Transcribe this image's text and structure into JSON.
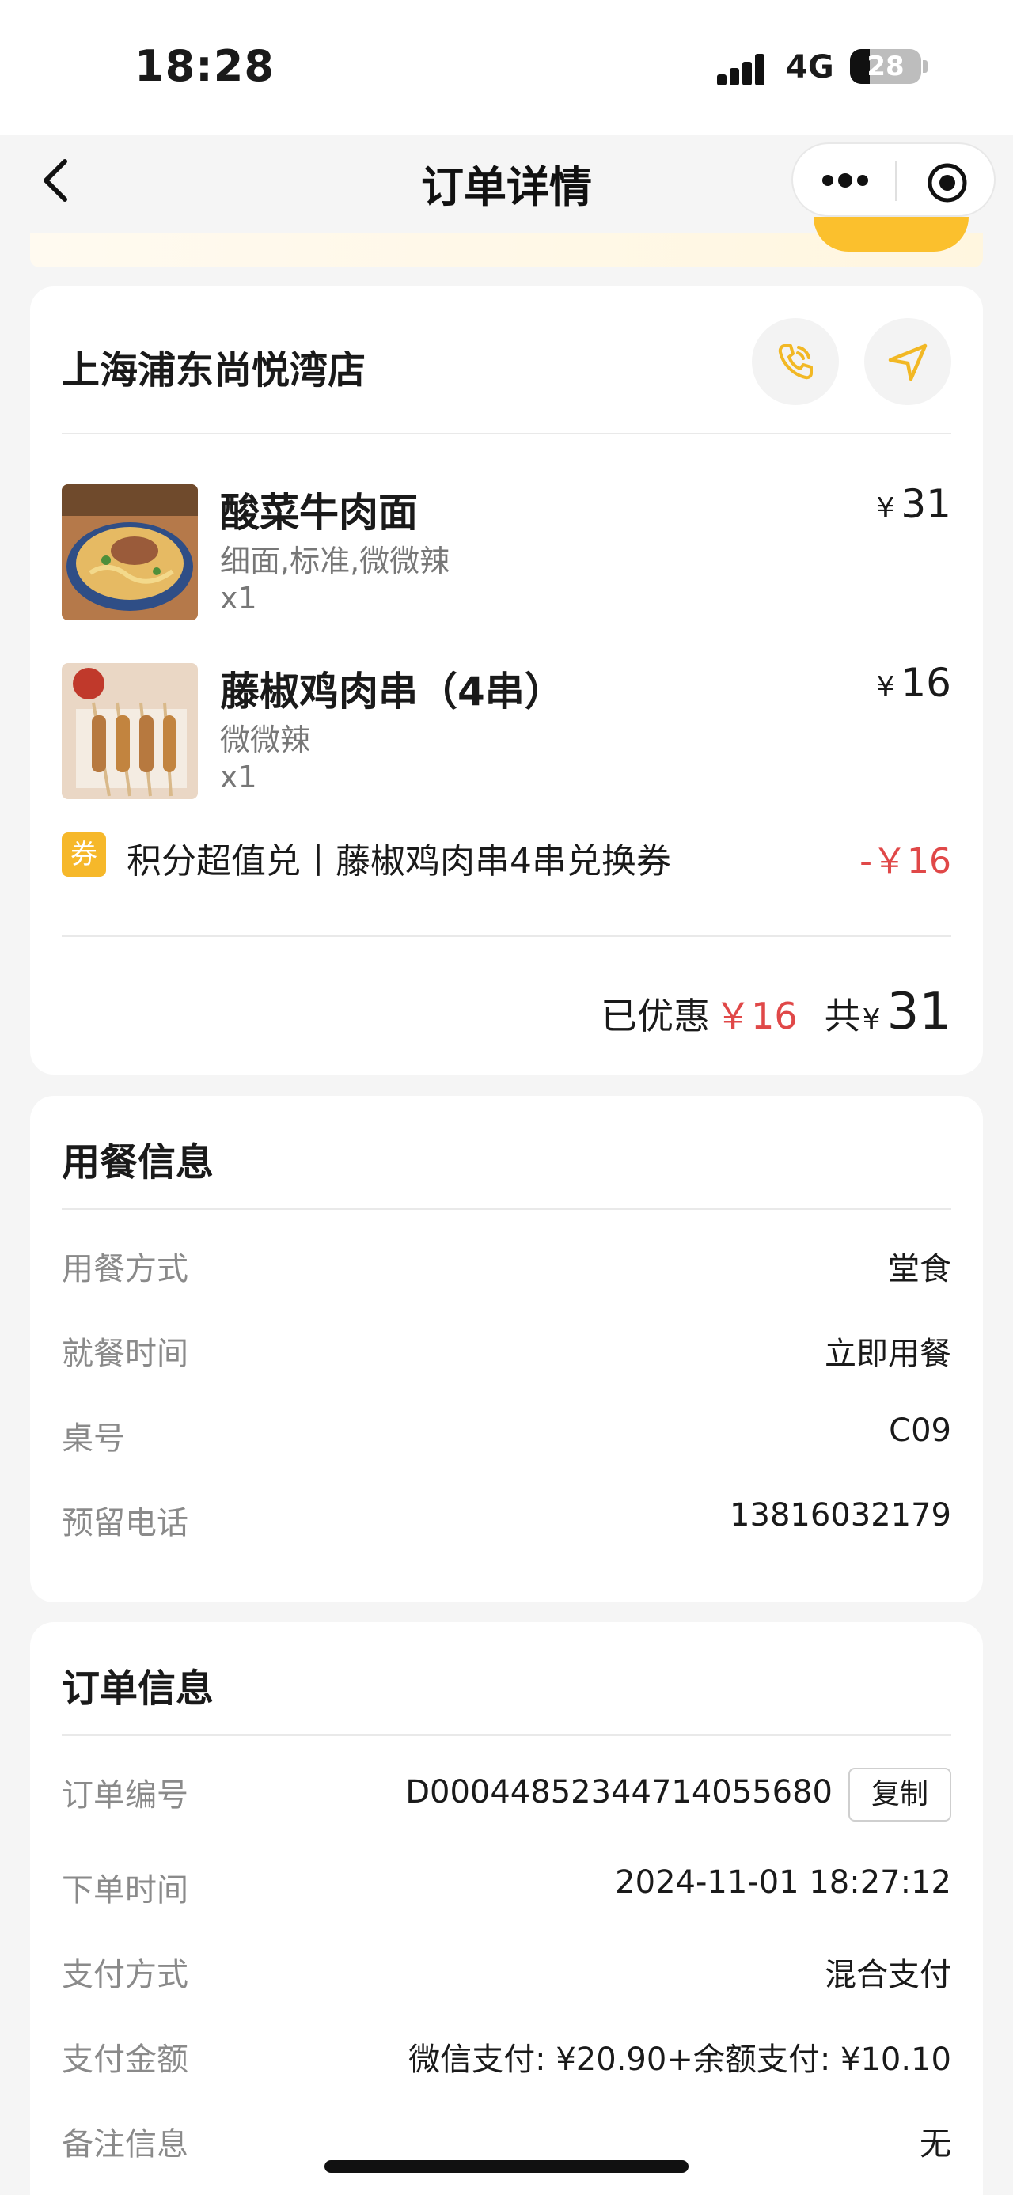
{
  "status_bar": {
    "time": "18:28",
    "network": "4G",
    "battery_level": "28"
  },
  "nav": {
    "title": "订单详情"
  },
  "store": {
    "name": "上海浦东尚悦湾店",
    "items": [
      {
        "name": "酸菜牛肉面",
        "spec": "细面,标准,微微辣",
        "qty": "x1",
        "currency": "¥",
        "price": "31"
      },
      {
        "name": "藤椒鸡肉串（4串）",
        "spec": "微微辣",
        "qty": "x1",
        "currency": "¥",
        "price": "16"
      }
    ],
    "coupon": {
      "badge": "券",
      "text": "积分超值兑丨藤椒鸡肉串4串兑换券",
      "amount": "-￥16"
    },
    "summary": {
      "discount_label": "已优惠",
      "discount_value": "￥16",
      "total_label": "共",
      "total_currency": "¥",
      "total_value": "31"
    }
  },
  "dining_info": {
    "title": "用餐信息",
    "rows": [
      {
        "label": "用餐方式",
        "value": "堂食"
      },
      {
        "label": "就餐时间",
        "value": "立即用餐"
      },
      {
        "label": "桌号",
        "value": "C09"
      },
      {
        "label": "预留电话",
        "value": "13816032179"
      }
    ]
  },
  "order_info": {
    "title": "订单信息",
    "copy_label": "复制",
    "rows": [
      {
        "label": "订单编号",
        "value": "D00044852344714055680"
      },
      {
        "label": "下单时间",
        "value": "2024-11-01 18:27:12"
      },
      {
        "label": "支付方式",
        "value": "混合支付"
      },
      {
        "label": "支付金额",
        "value": "微信支付: ¥20.90+余额支付: ¥10.10"
      },
      {
        "label": "备注信息",
        "value": "无"
      }
    ]
  },
  "colors": {
    "accent": "#f6b82a",
    "discount_red": "#e04848",
    "icon_yellow": "#f2b824"
  }
}
